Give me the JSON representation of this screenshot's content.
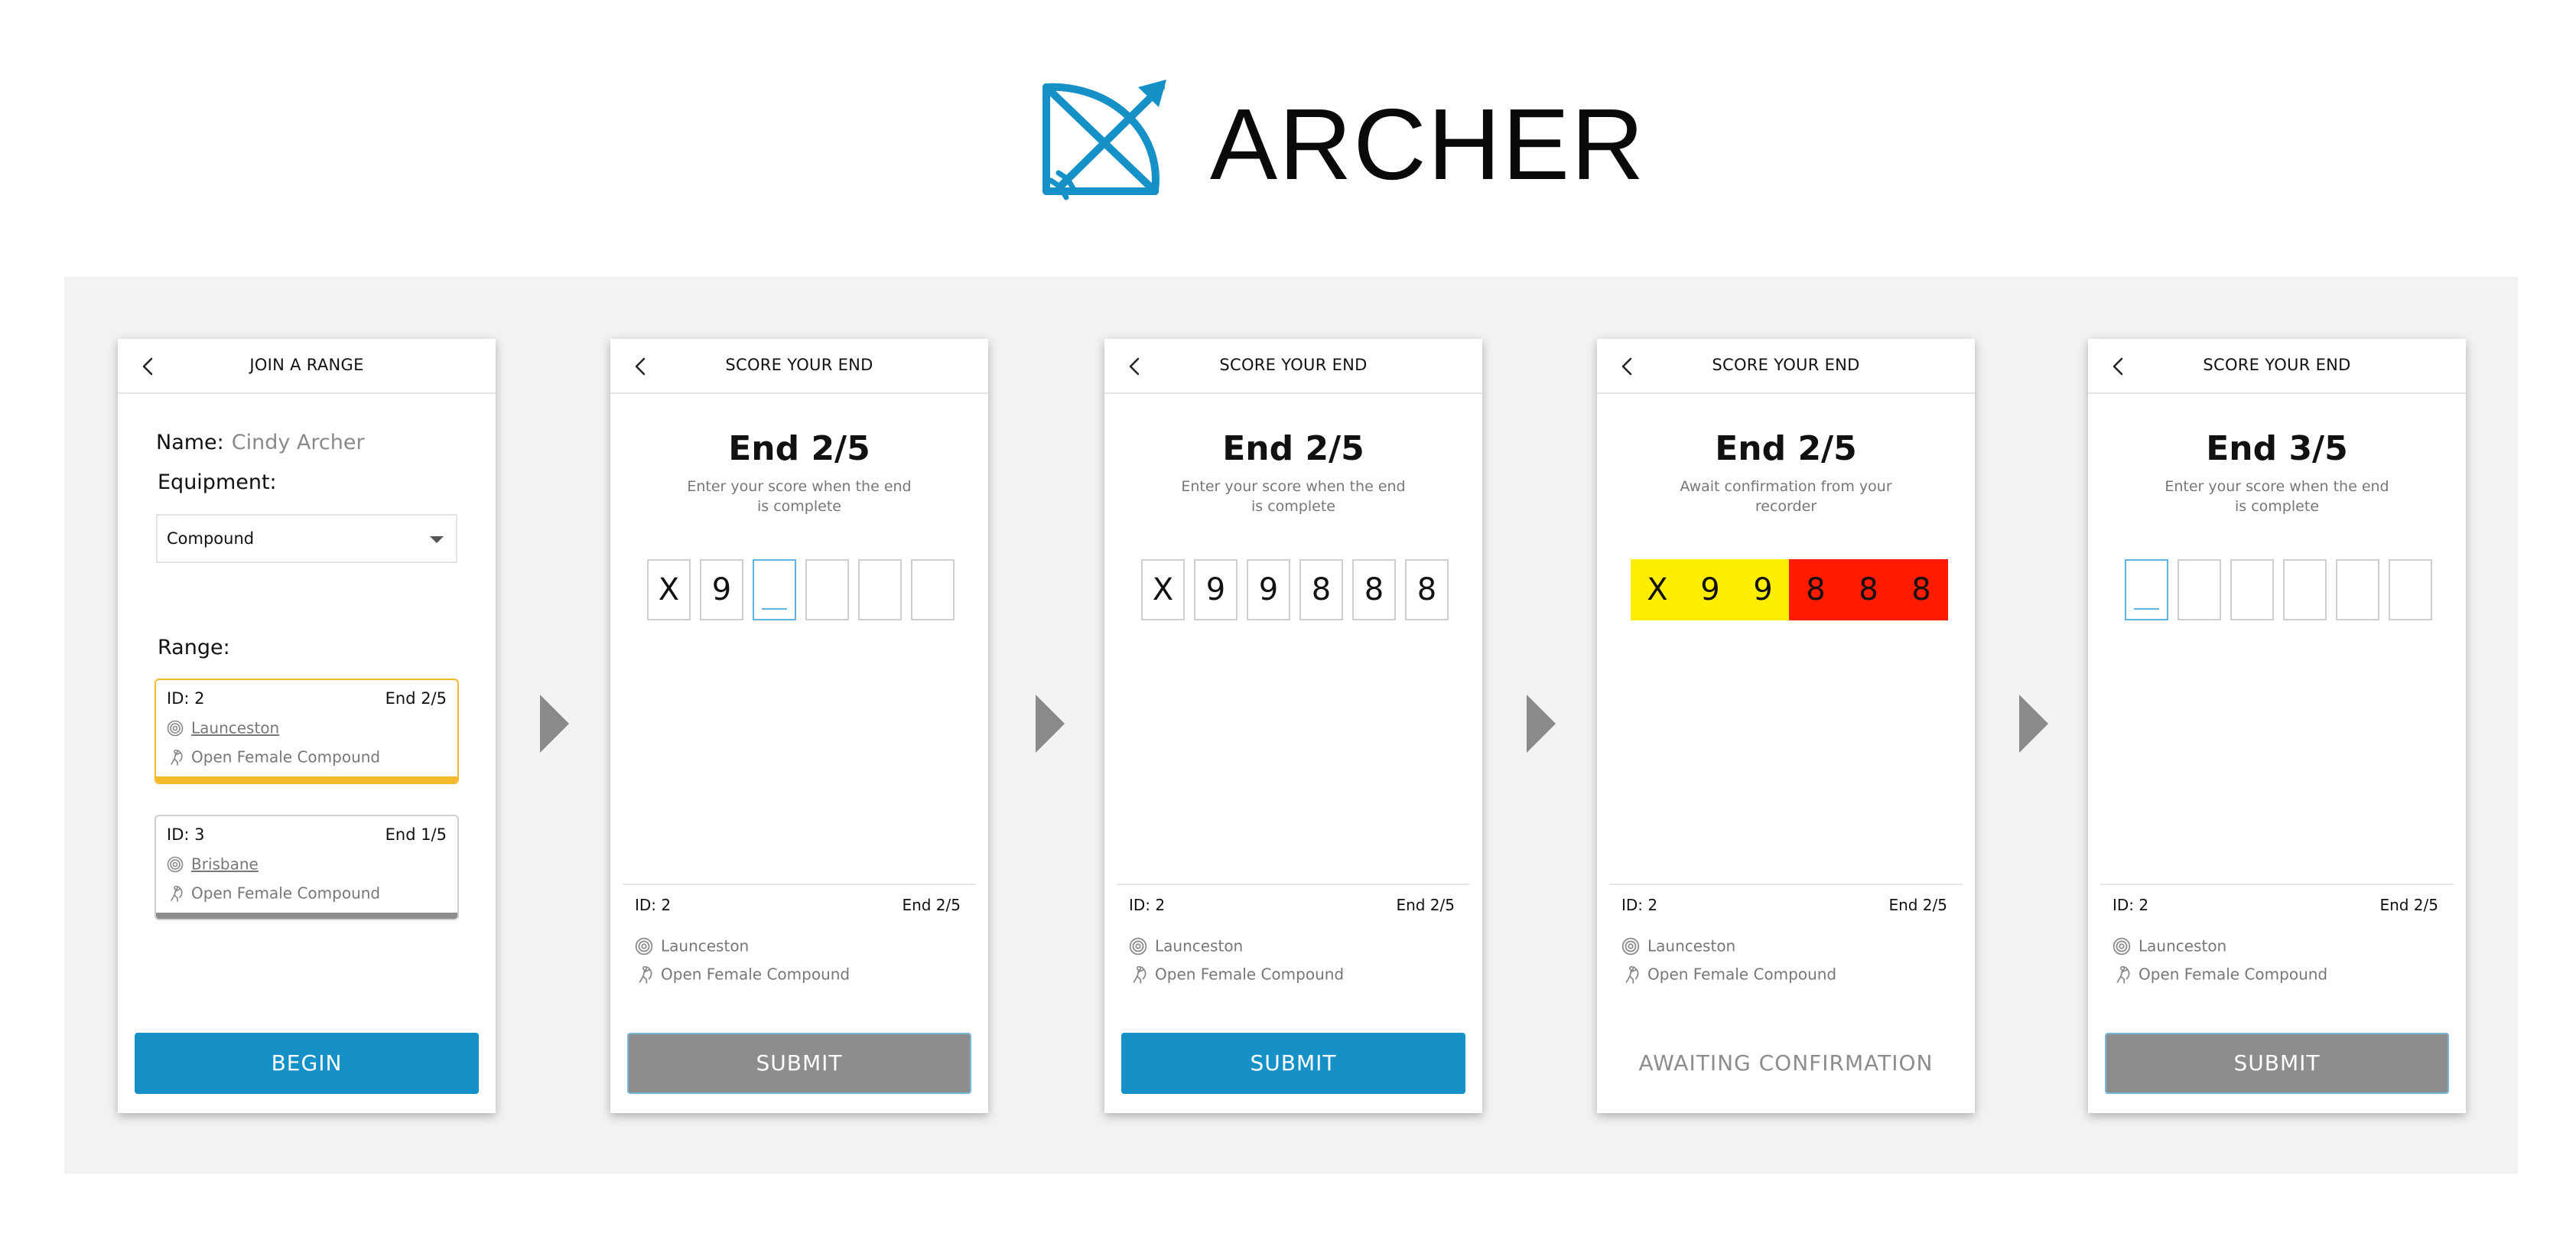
{
  "app": {
    "logo_text": "ARCHER",
    "brand_color": "#1591c8"
  },
  "colors": {
    "selected": "#f5b92c",
    "score_yellow": "#ffee00",
    "score_red": "#ff1a00",
    "button_grey": "#8d8d8d"
  },
  "screen1": {
    "header": "JOIN A RANGE",
    "name_label": "Name:",
    "name_value": "Cindy Archer",
    "equipment_label": "Equipment:",
    "equipment_value": "Compound",
    "range_label": "Range:",
    "ranges": [
      {
        "id": "ID: 2",
        "end": "End 2/5",
        "location": "Launceston",
        "division": "Open Female Compound",
        "selected": true
      },
      {
        "id": "ID: 3",
        "end": "End 1/5",
        "location": "Brisbane",
        "division": "Open Female Compound",
        "selected": false
      }
    ],
    "button": "BEGIN"
  },
  "screen2": {
    "header": "SCORE YOUR END",
    "title": "End 2/5",
    "subtitle": "Enter your score when the end is complete",
    "scores": [
      "X",
      "9",
      "",
      "",
      "",
      ""
    ],
    "info": {
      "id": "ID: 2",
      "end": "End 2/5",
      "location": "Launceston",
      "division": "Open Female Compound"
    },
    "button": "SUBMIT"
  },
  "screen3": {
    "header": "SCORE YOUR END",
    "title": "End 2/5",
    "subtitle": "Enter your score when the end is complete",
    "scores": [
      "X",
      "9",
      "9",
      "8",
      "8",
      "8"
    ],
    "info": {
      "id": "ID: 2",
      "end": "End 2/5",
      "location": "Launceston",
      "division": "Open Female Compound"
    },
    "button": "SUBMIT"
  },
  "screen4": {
    "header": "SCORE YOUR END",
    "title": "End 2/5",
    "subtitle": "Await confirmation from your recorder",
    "scores": [
      "X",
      "9",
      "9",
      "8",
      "8",
      "8"
    ],
    "info": {
      "id": "ID: 2",
      "end": "End 2/5",
      "location": "Launceston",
      "division": "Open Female Compound"
    },
    "status": "AWAITING CONFIRMATION"
  },
  "screen5": {
    "header": "SCORE YOUR END",
    "title": "End 3/5",
    "subtitle": "Enter your score when the end is complete",
    "scores": [
      "",
      "",
      "",
      "",
      "",
      ""
    ],
    "info": {
      "id": "ID: 2",
      "end": "End 2/5",
      "location": "Launceston",
      "division": "Open Female Compound"
    },
    "button": "SUBMIT"
  },
  "icons": {
    "back": "chevron-left-icon",
    "location": "target-icon",
    "division": "archer-icon",
    "logo": "bow-arrow-icon",
    "flow": "flow-arrow-icon"
  }
}
